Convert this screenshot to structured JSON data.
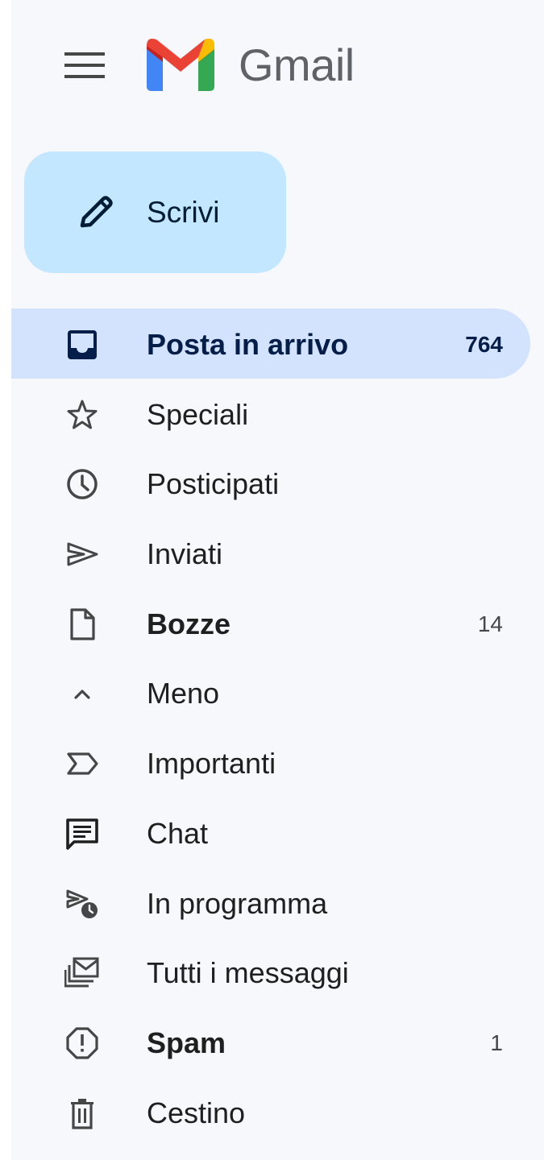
{
  "header": {
    "menu_icon": "hamburger-menu-icon",
    "logo_icon": "gmail-logo-icon",
    "brand": "Gmail"
  },
  "compose": {
    "icon": "pencil-icon",
    "label": "Scrivi"
  },
  "colors": {
    "background": "#f6f8fc",
    "compose_bg": "#c2e7ff",
    "active_bg": "#d3e3fd",
    "active_text": "#041e49",
    "text": "#1f1f1f",
    "brand_text": "#5f6368"
  },
  "nav": {
    "items": [
      {
        "label": "Posta in arrivo",
        "count": "764",
        "icon": "inbox-icon",
        "active": true,
        "bold": true
      },
      {
        "label": "Speciali",
        "count": "",
        "icon": "star-icon",
        "active": false,
        "bold": false
      },
      {
        "label": "Posticipati",
        "count": "",
        "icon": "clock-icon",
        "active": false,
        "bold": false
      },
      {
        "label": "Inviati",
        "count": "",
        "icon": "send-icon",
        "active": false,
        "bold": false
      },
      {
        "label": "Bozze",
        "count": "14",
        "icon": "draft-icon",
        "active": false,
        "bold": true
      },
      {
        "label": "Meno",
        "count": "",
        "icon": "chevron-up-icon",
        "active": false,
        "bold": false
      },
      {
        "label": "Importanti",
        "count": "",
        "icon": "label-important-icon",
        "active": false,
        "bold": false
      },
      {
        "label": "Chat",
        "count": "",
        "icon": "chat-icon",
        "active": false,
        "bold": false
      },
      {
        "label": "In programma",
        "count": "",
        "icon": "scheduled-send-icon",
        "active": false,
        "bold": false
      },
      {
        "label": "Tutti i messaggi",
        "count": "",
        "icon": "all-mail-icon",
        "active": false,
        "bold": false
      },
      {
        "label": "Spam",
        "count": "1",
        "icon": "spam-icon",
        "active": false,
        "bold": true
      },
      {
        "label": "Cestino",
        "count": "",
        "icon": "trash-icon",
        "active": false,
        "bold": false
      }
    ]
  }
}
